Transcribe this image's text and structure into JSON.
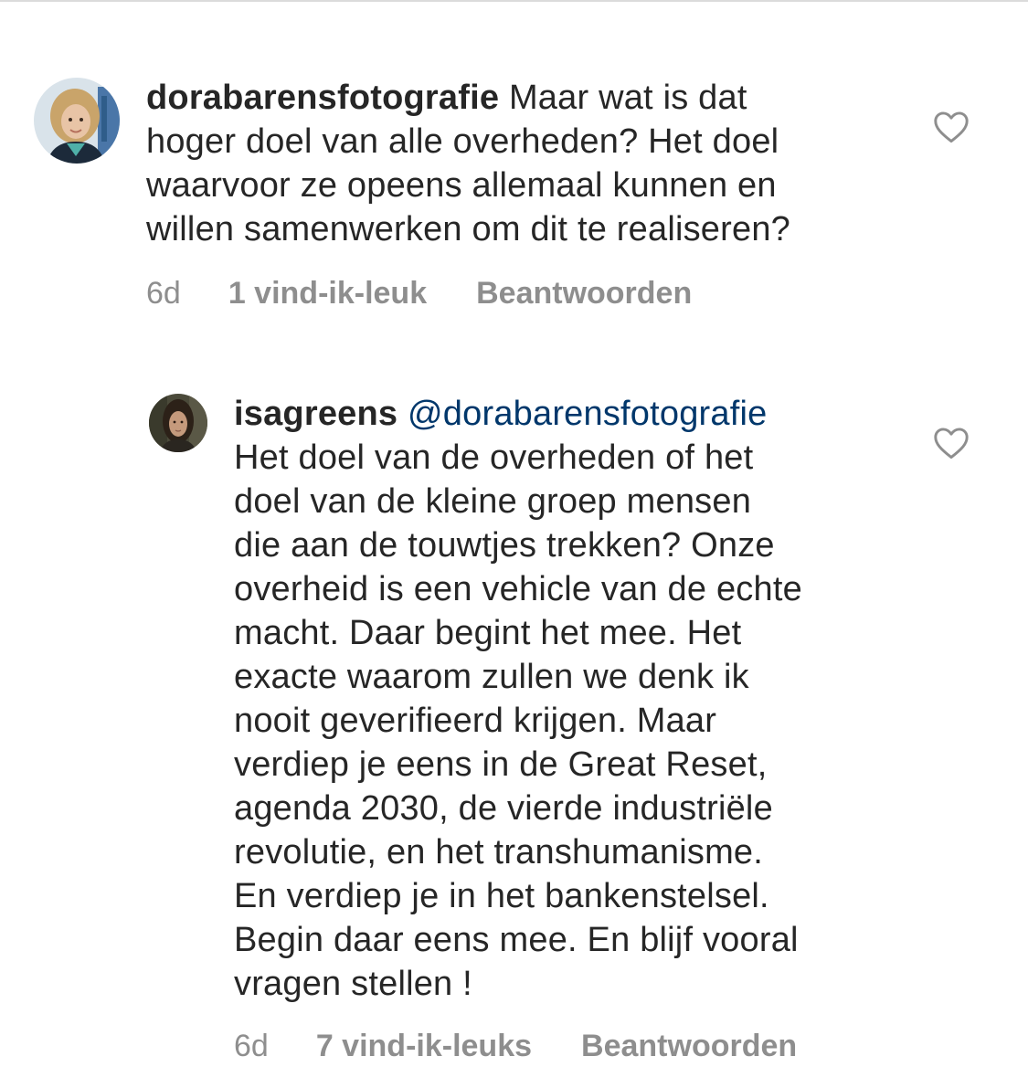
{
  "comments": [
    {
      "username": "dorabarensfotografie",
      "mention": "",
      "text": "Maar wat is dat\nhoger doel van alle overheden? Het doel\nwaarvoor ze opeens allemaal kunnen en\nwillen samenwerken om dit te realiseren?",
      "time": "6d",
      "likes": "1 vind-ik-leuk",
      "reply": "Beantwoorden",
      "like_icon": "heart-outline-icon",
      "avatar_icon": "profile-photo"
    },
    {
      "username": "isagreens",
      "mention": "@dorabarensfotografie",
      "text": "Het doel van de overheden of het\ndoel van de kleine groep mensen\ndie aan de touwtjes trekken? Onze\noverheid is een vehicle van de echte\nmacht. Daar begint het mee. Het\nexacte waarom zullen we denk ik\nnooit geverifieerd krijgen. Maar\nverdiep je eens in de Great Reset,\nagenda 2030, de vierde industriële\nrevolutie, en het transhumanisme.\nEn verdiep je in het bankenstelsel.\nBegin daar eens mee. En blijf vooral\nvragen stellen !",
      "time": "6d",
      "likes": "7 vind-ik-leuks",
      "reply": "Beantwoorden",
      "like_icon": "heart-outline-icon",
      "avatar_icon": "profile-photo"
    }
  ],
  "colors": {
    "text": "#262626",
    "meta": "#8e8e8e",
    "mention": "#00376b",
    "divider": "#dbdbdb"
  }
}
